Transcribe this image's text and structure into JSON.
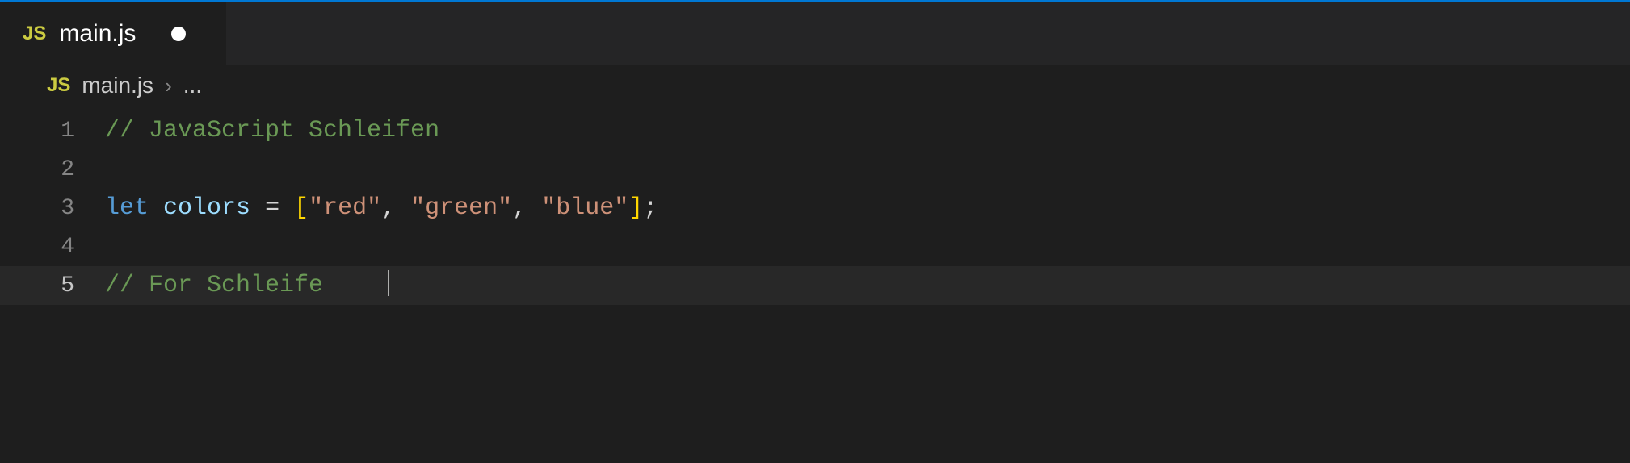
{
  "tab": {
    "icon_label": "JS",
    "filename": "main.js",
    "dirty": true
  },
  "breadcrumb": {
    "icon_label": "JS",
    "filename": "main.js",
    "separator": "›",
    "ellipsis": "..."
  },
  "editor": {
    "lines": [
      {
        "num": "1",
        "tokens": [
          {
            "cls": "comment",
            "t": "// JavaScript Schleifen"
          }
        ]
      },
      {
        "num": "2",
        "tokens": []
      },
      {
        "num": "3",
        "tokens": [
          {
            "cls": "keyword",
            "t": "let"
          },
          {
            "cls": "",
            "t": " "
          },
          {
            "cls": "variable",
            "t": "colors"
          },
          {
            "cls": "",
            "t": " "
          },
          {
            "cls": "operator",
            "t": "="
          },
          {
            "cls": "",
            "t": " "
          },
          {
            "cls": "bracket-y",
            "t": "["
          },
          {
            "cls": "string",
            "t": "\"red\""
          },
          {
            "cls": "punctuation",
            "t": ", "
          },
          {
            "cls": "string",
            "t": "\"green\""
          },
          {
            "cls": "punctuation",
            "t": ", "
          },
          {
            "cls": "string",
            "t": "\"blue\""
          },
          {
            "cls": "bracket-y",
            "t": "]"
          },
          {
            "cls": "punctuation",
            "t": ";"
          }
        ]
      },
      {
        "num": "4",
        "tokens": []
      },
      {
        "num": "5",
        "current": true,
        "cursor": true,
        "tokens": [
          {
            "cls": "comment",
            "t": "// For Schleife"
          }
        ]
      }
    ]
  }
}
